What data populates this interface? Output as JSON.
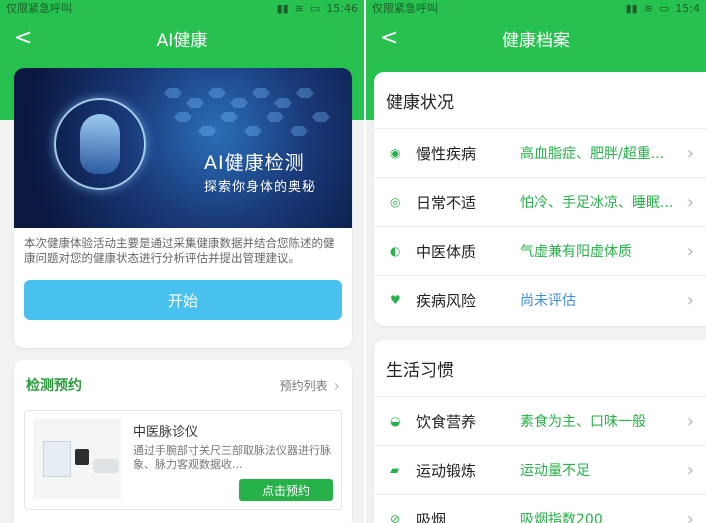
{
  "left": {
    "status": {
      "carrier": "仅限紧急呼叫",
      "time": "15:46"
    },
    "header": {
      "title": "AI健康"
    },
    "hero": {
      "title": "AI健康检测",
      "subtitle": "探索你身体的奥秘"
    },
    "description": "本次健康体验活动主要是通过采集健康数据并结合您陈述的健康问题对您的健康状态进行分析评估并提出管理建议。",
    "start_button": "开始",
    "booking": {
      "title": "检测预约",
      "list_link": "预约列表",
      "product": {
        "name": "中医脉诊仪",
        "description": "通过手腕部寸关尺三部取脉法仪器进行脉象、脉力客观数据收...",
        "button": "点击预约"
      }
    }
  },
  "right": {
    "status": {
      "carrier": "仅限紧急呼叫",
      "time": "15:4"
    },
    "header": {
      "title": "健康档案"
    },
    "health_status": {
      "title": "健康状况",
      "rows": [
        {
          "icon": "camera-icon",
          "label": "慢性疾病",
          "value": "高血脂症、肥胖/超重..."
        },
        {
          "icon": "eye-icon",
          "label": "日常不适",
          "value": "怕冷、手足冰凉、睡眠..."
        },
        {
          "icon": "yin-yang-icon",
          "label": "中医体质",
          "value": "气虚兼有阳虚体质"
        },
        {
          "icon": "heartbeat-icon",
          "label": "疾病风险",
          "value": "尚未评估"
        }
      ]
    },
    "habits": {
      "title": "生活习惯",
      "rows": [
        {
          "icon": "bowl-icon",
          "label": "饮食营养",
          "value": "素食为主、口味一般"
        },
        {
          "icon": "shoe-icon",
          "label": "运动锻炼",
          "value": "运动量不足"
        },
        {
          "icon": "no-smoking-icon",
          "label": "吸烟",
          "value": "吸烟指数200"
        }
      ]
    }
  },
  "colors": {
    "brand_green": "#27c14f",
    "accent_blue": "#49c1ef",
    "link_blue": "#3c8cd8"
  }
}
